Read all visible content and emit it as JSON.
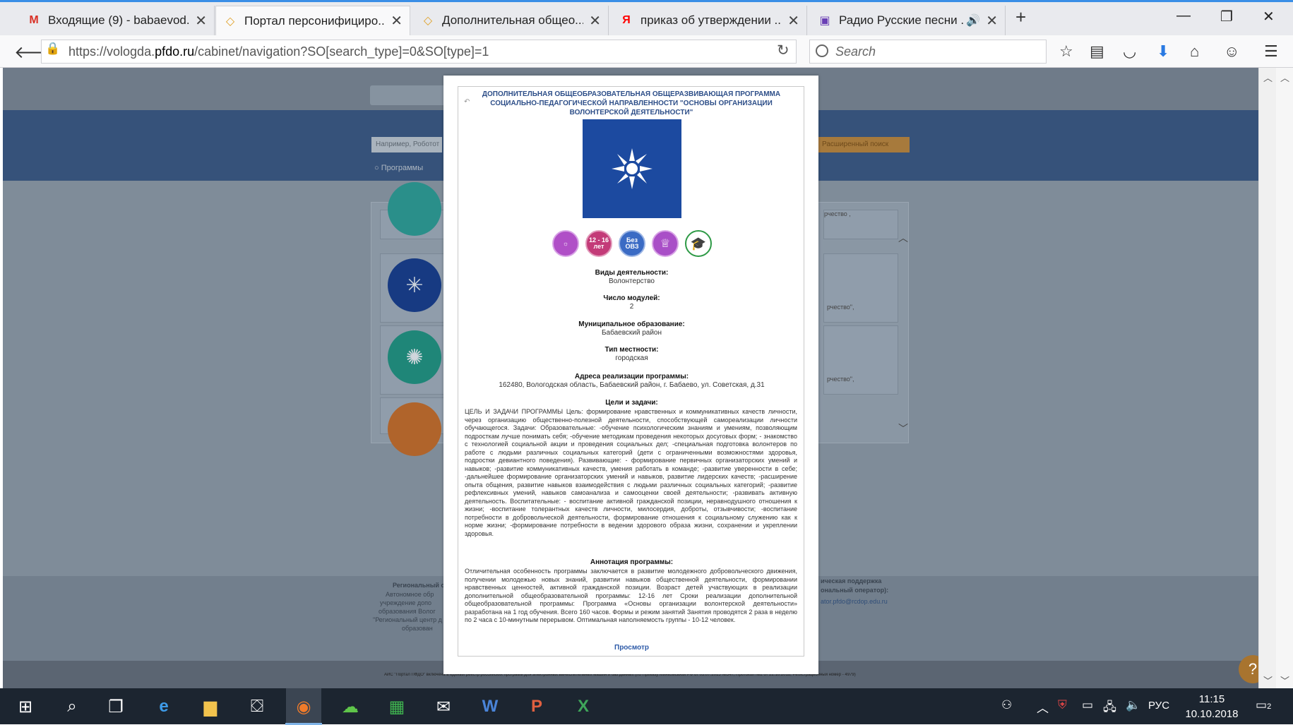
{
  "browser": {
    "tabs": [
      {
        "title": "Входящие (9) - babaevod...",
        "favicon": "gmail-icon",
        "favicon_text": "M",
        "favicon_color": "#d93025",
        "active": false
      },
      {
        "title": "Портал персонифициро...",
        "favicon": "pfdo-icon",
        "favicon_text": "◇",
        "favicon_color": "#e0a22a",
        "active": true
      },
      {
        "title": "Дополнительная общео...",
        "favicon": "pfdo-icon",
        "favicon_text": "◇",
        "favicon_color": "#e0a22a",
        "active": false
      },
      {
        "title": "приказ об утверждении ...",
        "favicon": "yandex-icon",
        "favicon_text": "Я",
        "favicon_color": "#ff0000",
        "active": false
      },
      {
        "title": "Радио Русские песни ...",
        "favicon": "radio-icon",
        "favicon_text": "▣",
        "favicon_color": "#6a3fb5",
        "active": false
      }
    ],
    "url_prefix": "https://vologda.",
    "url_domain": "pfdo.ru",
    "url_suffix": "/cabinet/navigation?SO[search_type]=0&SO[type]=1",
    "search_placeholder": "Search"
  },
  "page": {
    "search_placeholder": "Например, Роботот",
    "advanced_search_label": "Расширенный поиск",
    "programs_label": "Программы",
    "card_snippet_1": "рчество\",",
    "card_snippet_2": "рчество\",",
    "card_snippet_top": "рчество ,",
    "footer_left_1": "Региональный с",
    "footer_left_2": "Автономное обр",
    "footer_left_3": "учреждение допо",
    "footer_left_4": "образования Волог",
    "footer_left_5": "\"Региональный центр д",
    "footer_left_6": "образован",
    "footer_right_1": "ическая поддержка",
    "footer_right_2": "ональный оператор):",
    "footer_right_3": "ator.pfdo@rcdop.edu.ru",
    "footer_bottom": "АИС \"Портал ПФДО\" включена в единый реестр российских программ для электронных вычислительных машин и баз данных (по Приказу Минкомсвязи РФ от 03.07.2015 №547, Протокол №2 от 22.10.2018, Регистрационный номер - 4979)"
  },
  "modal": {
    "title": "ДОПОЛНИТЕЛЬНАЯ ОБЩЕОБРАЗОВАТЕЛЬНАЯ ОБЩЕРАЗВИВАЮЩАЯ ПРОГРАММА СОЦИАЛЬНО-ПЕДАГОГИЧЕСКОЙ НАПРАВЛЕННОСТИ \"ОСНОВЫ ОРГАНИЗАЦИИ ВОЛОНТЕРСКОЙ ДЕЯТЕЛЬНОСТИ\"",
    "badges": [
      {
        "icon": "sun-icon",
        "text": "",
        "color": "#b04fc7"
      },
      {
        "icon": "age-icon",
        "text": "12 - 16 лет",
        "color": "#c33b78"
      },
      {
        "icon": "ovz-icon",
        "text": "Без ОВЗ",
        "color": "#3b6bc4"
      },
      {
        "icon": "award-icon",
        "text": "",
        "color": "#a94fc7"
      },
      {
        "icon": "graduation-cap-icon",
        "text": "",
        "color": "#2e9a46"
      }
    ],
    "fields": {
      "activity_label": "Виды деятельности:",
      "activity_value": "Волонтерство",
      "modules_label": "Число модулей:",
      "modules_value": "2",
      "municipality_label": "Муниципальное образование:",
      "municipality_value": "Бабаевский район",
      "area_type_label": "Тип местности:",
      "area_type_value": "городская",
      "address_label": "Адреса реализации программы:",
      "address_value": "162480, Вологодская область, Бабаевский район, г. Бабаево, ул. Советская, д.31"
    },
    "goals_label": "Цели и задачи:",
    "goals_text": "ЦЕЛЬ И ЗАДАЧИ ПРОГРАММЫ Цель: формирование нравственных и коммуникативных качеств личности, через организацию общественно-полезной деятельности, способствующей самореализации личности обучающегося. Задачи: Образовательные: -обучение психологическим знаниям и умениям, позволяющим подросткам лучше понимать себя; -обучение методикам проведения некоторых досуговых форм; - знакомство с технологией социальной акции и проведения социальных дел; -специальная подготовка волонтеров по работе с людьми различных социальных категорий (дети с ограниченными возможностями здоровья, подростки девиантного поведения). Развивающие: - формирование первичных организаторских умений и навыков; -развитие коммуникативных качеств, умения работать в команде; -развитие уверенности в себе; -дальнейшее формирование организаторских умений и навыков, развитие лидерских качеств; -расширение опыта общения, развитие навыков взаимодействия с людьми различных социальных категорий; -развитие рефлексивных умений, навыков самоанализа и самооценки своей деятельности; -развивать активную деятельность. Воспитательные: - воспитание активной гражданской позиции, неравнодушного отношения к жизни; -воспитание толерантных качеств личности, милосердия, доброты, отзывчивости; -воспитание потребности в добровольческой деятельности, формирование отношения к социальному служению как к норме жизни; -формирование потребности в ведении здорового образа жизни, сохранении и укреплении здоровья.",
    "annotation_label": "Аннотация программы:",
    "annotation_text": "Отличительная особенность программы заключается в развитие молодежного добровольческого движения, получении молодежью новых знаний, развитии навыков общественной деятельности, формировании нравственных ценностей, активной гражданской позиции. Возраст детей участвующих в реализации дополнительной общеобразовательной программы: 12-16 лет Сроки реализации дополнительной общеобразовательной программы: Программа «Основы организации волонтерской деятельности» разработана на 1 год обучения. Всего 160 часов. Формы и режим занятий Занятия проводятся 2 раза в неделю по 2 часа с 10-минутным перерывом. Оптимальная наполняемость группы - 10-12 человек.",
    "view_link": "Просмотр"
  },
  "taskbar": {
    "lang": "РУС",
    "time": "11:15",
    "date": "10.10.2018",
    "notifications": "2"
  },
  "colors": {
    "accent": "#3a8ee6",
    "modal_title": "#2d4e88",
    "hero_bg": "#1c4aa0",
    "taskbar_bg": "#1c2530"
  }
}
